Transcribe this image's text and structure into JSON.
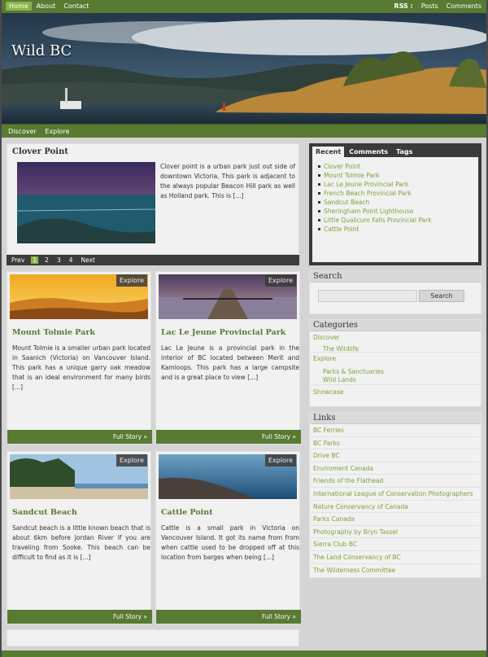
{
  "topnav": {
    "items": [
      {
        "label": "Home",
        "active": true
      },
      {
        "label": "About"
      },
      {
        "label": "Contact"
      }
    ],
    "rss_label": "RSS :",
    "rss_links": [
      "Posts",
      "Comments"
    ]
  },
  "header": {
    "site_title": "Wild BC"
  },
  "subnav": {
    "items": [
      "Discover",
      "Explore"
    ]
  },
  "featured": {
    "title": "Clover Point",
    "excerpt": "Clover point is a urban park just out side of downtown Victoria. This park is adjacent to the always popular Beacon Hill park as well as Holland park. This is [...]"
  },
  "pager": {
    "prev": "Prev",
    "pages": [
      "1",
      "2",
      "3",
      "4"
    ],
    "current": "1",
    "next": "Next"
  },
  "posts": [
    {
      "title": "Mount Tolmie Park",
      "badge": "Explore",
      "excerpt": "Mount Tolmie is a smaller urban park located in Saanich (Victoria) on Vancouver Island. This park has a unique garry oak meadow that is an ideal environment for many birds [...]",
      "more": "Full Story »"
    },
    {
      "title": "Lac Le Jeune Provincial Park",
      "badge": "Explore",
      "excerpt": "Lac Le Jeune is a provincial park in the interior of BC located between Merit and Kamloops. This park has a large campsite and is a great place to view [...]",
      "more": "Full Story »"
    },
    {
      "title": "Sandcut Beach",
      "badge": "Explore",
      "excerpt": "Sandcut beach is a little known beach that is about 6km before Jordan River if you are traveling from Sooke. This beach can be difficult to find as it is [...]",
      "more": "Full Story »"
    },
    {
      "title": "Cattle Point",
      "badge": "Explore",
      "excerpt": "Cattle is a small park in Victoria on Vancouver Island. It got its name from from when cattle used to be dropped off at this location from barges when being [...]",
      "more": "Full Story »"
    }
  ],
  "sidebar": {
    "tabs": [
      "Recent",
      "Comments",
      "Tags"
    ],
    "active_tab": "Recent",
    "recent": [
      "Clover Point",
      "Mount Tolmie Park",
      "Lac Le Jeune Provincial Park",
      "French Beach Provincial Park",
      "Sandcut Beach",
      "Sheringham Point Lighthouse",
      "Little Qualicum Falls Provincial Park",
      "Cattle Point"
    ],
    "search": {
      "title": "Search",
      "button": "Search"
    },
    "categories": {
      "title": "Categories",
      "discover": "Discover",
      "wildlife": "The Wildlife",
      "explore": "Explore",
      "parks": "Parks & Sanctuaries",
      "wildlands": "Wild Lands",
      "showcase": "Showcase"
    },
    "links": {
      "title": "Links",
      "items": [
        "BC Ferries",
        "BC Parks",
        "Drive BC",
        "Enviroment Canada",
        "Friends of the Flathead",
        "International League of Conservation Photographers",
        "Nature Conservancy of Canada",
        "Parks Canada",
        "Photography by Bryn Tassel",
        "Sierra Club BC",
        "The Land Conservancy of BC",
        "The Wilderness Committee"
      ]
    }
  },
  "colors": {
    "green": "#587a31",
    "link_green": "#7da23d",
    "active_nav": "#8bb34a",
    "dark": "#3a3a3a"
  }
}
